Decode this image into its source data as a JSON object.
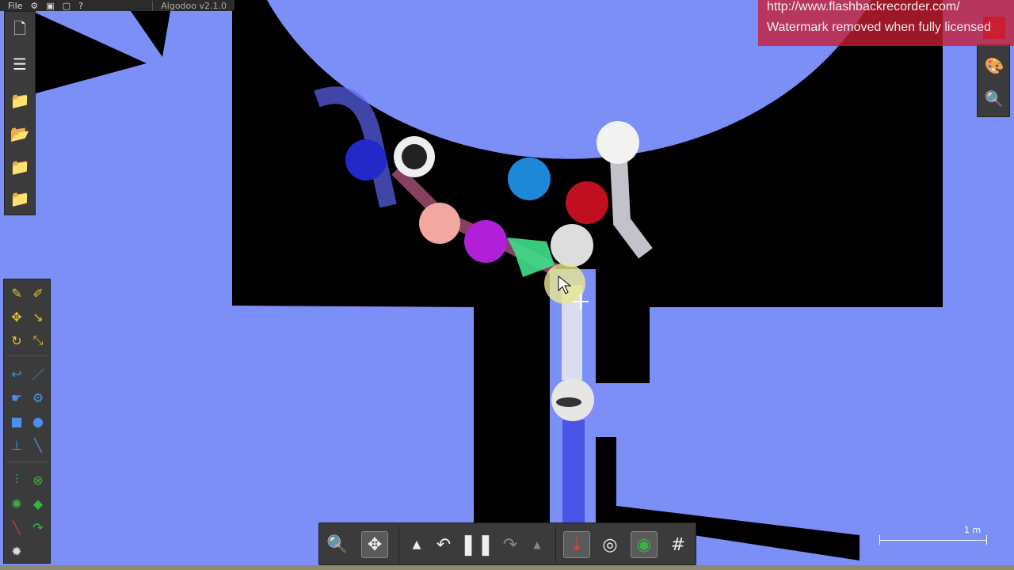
{
  "app": {
    "menu": [
      "File"
    ],
    "version_label": "Algodoo v2.1.0"
  },
  "watermark": {
    "line1": "http://www.flashbackrecorder.com/",
    "line2": "Watermark removed when fully licensed"
  },
  "scale_bar": {
    "label": "1 m"
  },
  "colors": {
    "background": "#7b8ff7",
    "terrain": "#000000",
    "toolbar": "#3b3b3b",
    "watermark_bg": "#c81e32"
  },
  "left_file_panel": [
    "new-scene-icon",
    "scene-list-icon",
    "open-folder-icon",
    "open-scene-icon",
    "save-icon",
    "save-as-icon"
  ],
  "tool_panel": [
    "sketch-tool-icon",
    "cut-tool-icon",
    "move-tool-icon",
    "drag-tool-icon",
    "rotate-tool-icon",
    "scale-tool-icon",
    "rope-tool-icon",
    "knife-tool-icon",
    "hinge-tool-icon",
    "gear-tool-icon",
    "box-tool-icon",
    "circle-tool-icon",
    "plane-tool-icon",
    "spring-tool-icon",
    "chain-tool-icon",
    "fixate-tool-icon",
    "thruster-tool-icon",
    "tracer-tool-icon",
    "laser-tool-icon",
    "rotation-tool-icon",
    "water-tool-icon"
  ],
  "right_panel": [
    "toolbox-icon",
    "appearance-icon",
    "zoom-find-icon"
  ],
  "bottom_bar": {
    "buttons": [
      "zoom-icon",
      "pan-icon",
      "speed-up-icon",
      "undo-icon",
      "pause-icon",
      "redo-icon",
      "speed-down-icon",
      "gravity-icon",
      "air-friction-icon",
      "drag-icon",
      "grid-icon"
    ]
  }
}
